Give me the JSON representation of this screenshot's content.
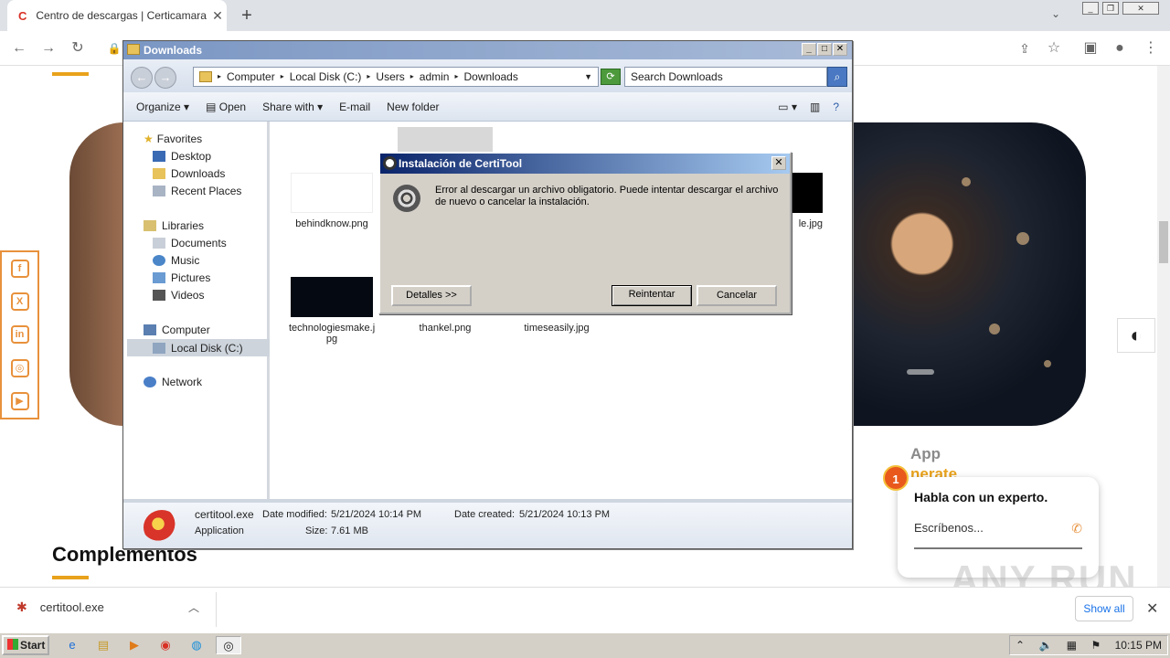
{
  "browser": {
    "tab_title": "Centro de descargas | Certicamara",
    "tab_favicon": "C"
  },
  "page": {
    "complementos_heading": "Complementos",
    "app_text": "App",
    "app_orange_text": "nerate",
    "chat": {
      "badge": "1",
      "heading": "Habla con un experto.",
      "input_placeholder": "Escríbenos..."
    },
    "watermark": "ANY RUN",
    "social_icons": [
      "facebook-icon",
      "x-icon",
      "linkedin-icon",
      "instagram-icon",
      "youtube-icon"
    ],
    "accent_color": "#e8a21b"
  },
  "download_bar": {
    "file_name": "certitool.exe",
    "show_all": "Show all"
  },
  "explorer": {
    "title": "Downloads",
    "breadcrumb": [
      "Computer",
      "Local Disk (C:)",
      "Users",
      "admin",
      "Downloads"
    ],
    "search_placeholder": "Search Downloads",
    "commands": {
      "organize": "Organize",
      "open": "Open",
      "share_with": "Share with",
      "email": "E-mail",
      "new_folder": "New folder"
    },
    "nav": {
      "favorites": "Favorites",
      "desktop": "Desktop",
      "downloads": "Downloads",
      "recent_places": "Recent Places",
      "libraries": "Libraries",
      "documents": "Documents",
      "music": "Music",
      "pictures": "Pictures",
      "videos": "Videos",
      "computer": "Computer",
      "local_disk": "Local Disk (C:)",
      "network": "Network"
    },
    "files": {
      "f1": "behindknow.png",
      "f2": "le.jpg",
      "f3": "technologiesmake.jpg",
      "f3_line1": "technologiesmake.j",
      "f3_line2": "pg",
      "f4": "thankel.png",
      "f5": "timeseasily.jpg"
    },
    "status": {
      "file_name": "certitool.exe",
      "date_modified_label": "Date modified:",
      "date_modified": "5/21/2024 10:14 PM",
      "date_created_label": "Date created:",
      "date_created": "5/21/2024 10:13 PM",
      "type": "Application",
      "size_label": "Size:",
      "size": "7.61 MB"
    }
  },
  "dialog": {
    "title": "Instalación de CertiTool",
    "message": "Error al descargar un archivo obligatorio. Puede intentar descargar el archivo de nuevo o cancelar la instalación.",
    "details_button": "Detalles >>",
    "retry_button": "Reintentar",
    "cancel_button": "Cancelar"
  },
  "taskbar": {
    "start": "Start",
    "clock": "10:15 PM"
  }
}
